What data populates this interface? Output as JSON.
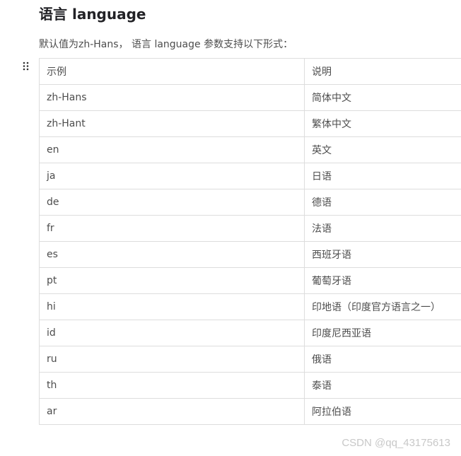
{
  "section": {
    "title": "语言 language"
  },
  "description": {
    "prefix": "默认值为",
    "default_value": "zh-Hans",
    "suffix": "， 语言 language 参数支持以下形式："
  },
  "table": {
    "headers": [
      "示例",
      "说明"
    ],
    "rows": [
      [
        "zh-Hans",
        "简体中文"
      ],
      [
        "zh-Hant",
        "繁体中文"
      ],
      [
        "en",
        "英文"
      ],
      [
        "ja",
        "日语"
      ],
      [
        "de",
        "德语"
      ],
      [
        "fr",
        "法语"
      ],
      [
        "es",
        "西班牙语"
      ],
      [
        "pt",
        "葡萄牙语"
      ],
      [
        "hi",
        "印地语（印度官方语言之一）"
      ],
      [
        "id",
        "印度尼西亚语"
      ],
      [
        "ru",
        "俄语"
      ],
      [
        "th",
        "泰语"
      ],
      [
        "ar",
        "阿拉伯语"
      ]
    ]
  },
  "watermark": "CSDN @qq_43175613",
  "icons": {
    "drag_handle": "drag-handle-icon"
  }
}
